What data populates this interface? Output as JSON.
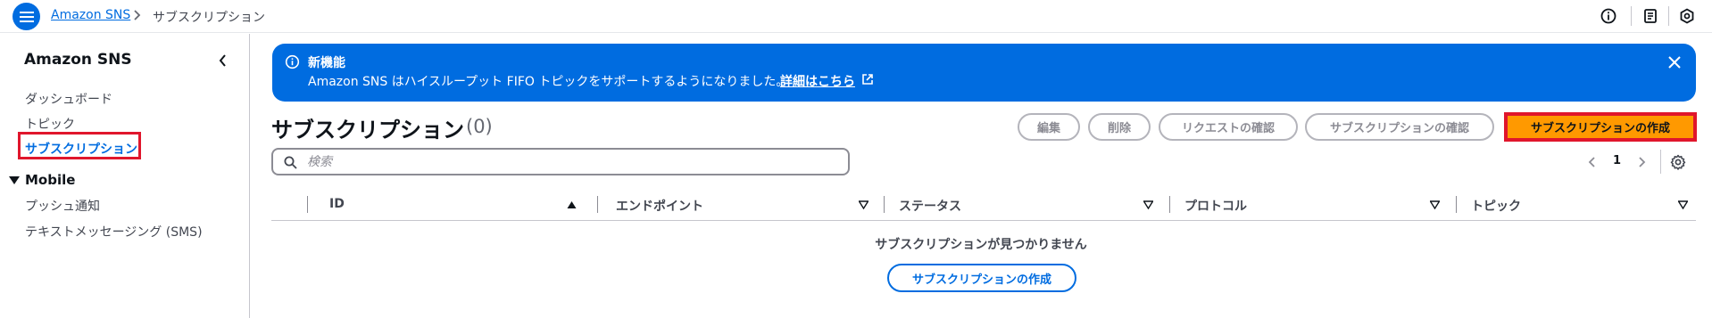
{
  "topbar": {
    "breadcrumb_root": "Amazon SNS",
    "breadcrumb_current": "サブスクリプション"
  },
  "sidebar": {
    "title": "Amazon SNS",
    "items": [
      {
        "label": "ダッシュボード"
      },
      {
        "label": "トピック"
      },
      {
        "label": "サブスクリプション"
      }
    ],
    "group": {
      "label": "Mobile",
      "items": [
        {
          "label": "プッシュ通知"
        },
        {
          "label": "テキストメッセージング (SMS)"
        }
      ]
    }
  },
  "flash": {
    "title": "新機能",
    "message": "Amazon SNS はハイスループット FIFO トピックをサポートするようになりました。",
    "link": "詳細はこちら"
  },
  "header": {
    "title": "サブスクリプション",
    "count": "(0)",
    "buttons": {
      "edit": "編集",
      "delete": "削除",
      "request_confirm": "リクエストの確認",
      "confirm_subscription": "サブスクリプションの確認",
      "create": "サブスクリプションの作成"
    }
  },
  "search": {
    "placeholder": "検索",
    "value": ""
  },
  "pagination": {
    "current_page": "1"
  },
  "table": {
    "columns": [
      "ID",
      "エンドポイント",
      "ステータス",
      "プロトコル",
      "トピック"
    ],
    "empty_message": "サブスクリプションが見つかりません",
    "empty_button": "サブスクリプションの作成"
  },
  "colors": {
    "accent": "#006ce0",
    "primary_button": "#ff9900",
    "highlight_border": "#e0162c"
  }
}
